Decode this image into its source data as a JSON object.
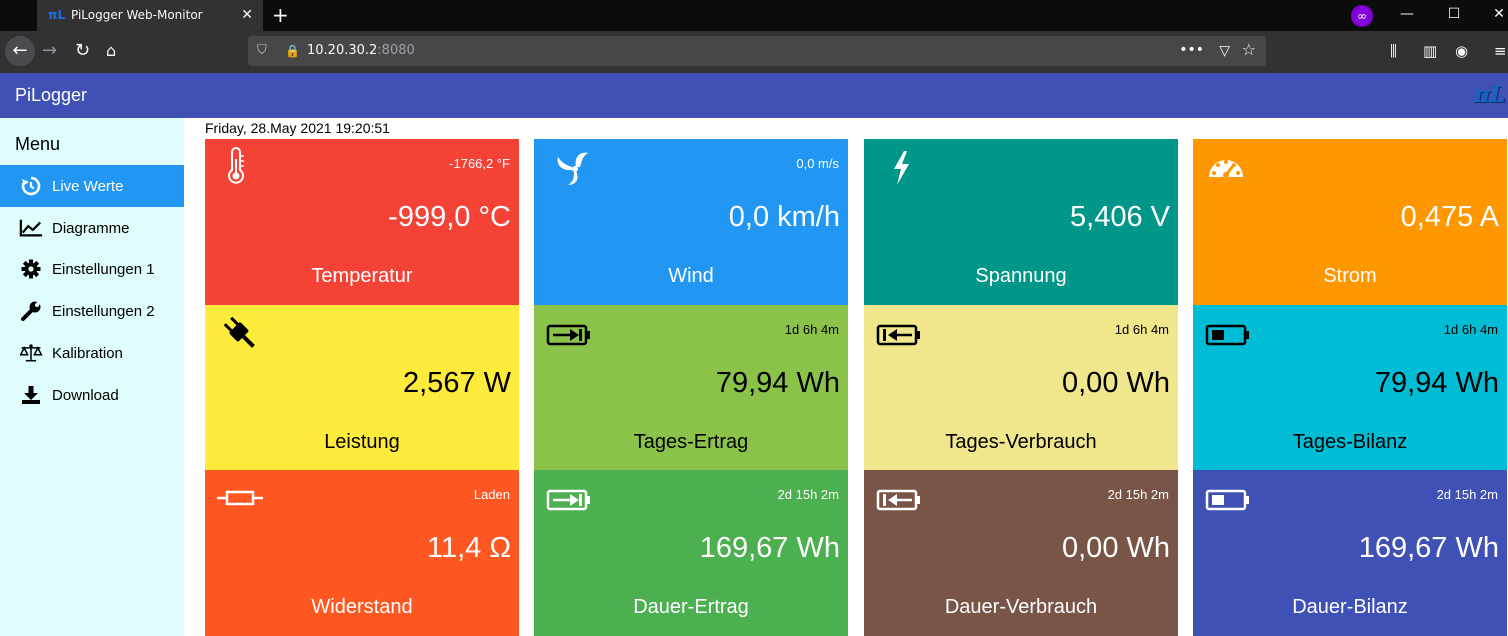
{
  "browser": {
    "tab_title": "PiLogger Web-Monitor",
    "url_host": "10.20.30.2",
    "url_port": ":8080"
  },
  "app": {
    "title": "PiLogger",
    "logo_text": "πL"
  },
  "sidebar": {
    "menu_title": "Menu",
    "items": [
      {
        "label": "Live Werte",
        "icon": "history-icon",
        "active": true
      },
      {
        "label": "Diagramme",
        "icon": "chart-icon",
        "active": false
      },
      {
        "label": "Einstellungen 1",
        "icon": "gear-icon",
        "active": false
      },
      {
        "label": "Einstellungen 2",
        "icon": "wrench-icon",
        "active": false
      },
      {
        "label": "Kalibration",
        "icon": "scale-icon",
        "active": false
      },
      {
        "label": "Download",
        "icon": "download-icon",
        "active": false
      }
    ]
  },
  "date": "Friday, 28.May 2021 19:20:51",
  "cards": [
    {
      "label": "Temperatur",
      "value": "-999,0 °C",
      "sub": "-1766,2 °F",
      "icon": "thermometer-icon",
      "color": "#f44336"
    },
    {
      "label": "Wind",
      "value": "0,0 km/h",
      "sub": "0,0 m/s",
      "icon": "fan-icon",
      "color": "#2196f3"
    },
    {
      "label": "Spannung",
      "value": "5,406 V",
      "sub": "",
      "icon": "lightning-icon",
      "color": "#009688"
    },
    {
      "label": "Strom",
      "value": "0,475 A",
      "sub": "",
      "icon": "gauge-icon",
      "color": "#ff9800"
    },
    {
      "label": "Leistung",
      "value": "2,567 W",
      "sub": "",
      "icon": "plug-icon",
      "color": "#ffeb3b"
    },
    {
      "label": "Tages-Ertrag",
      "value": "79,94 Wh",
      "sub": "1d 6h 4m",
      "icon": "battery-charge-icon",
      "color": "#8bc34a"
    },
    {
      "label": "Tages-Verbrauch",
      "value": "0,00 Wh",
      "sub": "1d 6h 4m",
      "icon": "battery-discharge-icon",
      "color": "#f0e68c"
    },
    {
      "label": "Tages-Bilanz",
      "value": "79,94 Wh",
      "sub": "1d 6h 4m",
      "icon": "battery-level-icon",
      "color": "#00bcd4"
    },
    {
      "label": "Widerstand",
      "value": "11,4 Ω",
      "sub": "Laden",
      "icon": "resistor-icon",
      "color": "#ff5722"
    },
    {
      "label": "Dauer-Ertrag",
      "value": "169,67 Wh",
      "sub": "2d 15h 2m",
      "icon": "battery-charge-icon",
      "color": "#4caf50"
    },
    {
      "label": "Dauer-Verbrauch",
      "value": "0,00 Wh",
      "sub": "2d 15h 2m",
      "icon": "battery-discharge-icon",
      "color": "#795548"
    },
    {
      "label": "Dauer-Bilanz",
      "value": "169,67 Wh",
      "sub": "2d 15h 2m",
      "icon": "battery-level-icon",
      "color": "#3f51b5"
    }
  ]
}
